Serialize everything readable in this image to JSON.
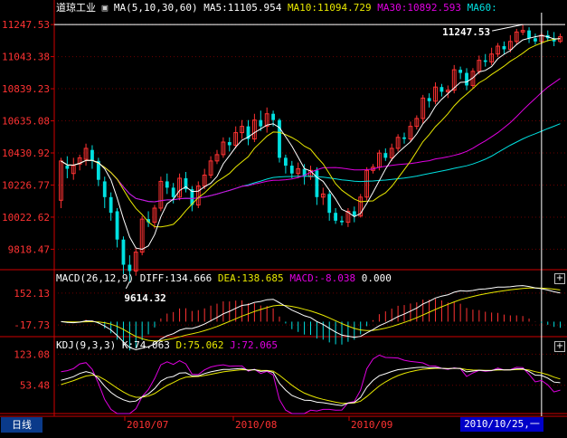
{
  "title": "道琼工业",
  "period_tab": "日线",
  "cursor_date": "2010/10/25,一",
  "colors": {
    "up": "#ff3232",
    "down": "#00e0e0",
    "ma5": "#ffffff",
    "ma10": "#e8e800",
    "ma30": "#e000e0",
    "ma60": "#00e0e0",
    "axis": "#d00000",
    "label": "#ff3232"
  },
  "legend_price": {
    "ma_label": "MA(5,10,30,60)",
    "ma5": "MA5:11105.954",
    "ma10": "MA10:11094.729",
    "ma30": "MA30:10892.593",
    "ma60": "MA60:"
  },
  "legend_macd": {
    "title": "MACD(26,12,9)",
    "diff": "DIFF:134.666",
    "dea": "DEA:138.685",
    "macd": "MACD:-8.038",
    "zero": "0.000"
  },
  "legend_kdj": {
    "title": "KDJ(9,3,3)",
    "k": "K:74.063",
    "d": "D:75.062",
    "j": "J:72.065"
  },
  "price_ticks": [
    "11247.53",
    "11043.38",
    "10839.23",
    "10635.08",
    "10430.92",
    "10226.77",
    "10022.62",
    "9818.47"
  ],
  "macd_ticks": [
    "152.13",
    "-17.73"
  ],
  "kdj_ticks": [
    "123.08",
    "53.48"
  ],
  "x_labels": [
    "2010/07",
    "2010/08",
    "2010/09"
  ],
  "chart_data": {
    "type": "candlestick",
    "title": "道琼工业",
    "period": "日线",
    "high_label": "11247.53",
    "low_label": "9614.32",
    "ylim": [
      9700,
      11300
    ],
    "candles": [
      [
        10130,
        10380,
        10080,
        10400
      ],
      [
        10350,
        10330,
        10270,
        10410
      ],
      [
        10300,
        10350,
        10260,
        10400
      ],
      [
        10360,
        10400,
        10320,
        10420
      ],
      [
        10390,
        10460,
        10350,
        10490
      ],
      [
        10450,
        10380,
        10330,
        10480
      ],
      [
        10380,
        10260,
        10220,
        10400
      ],
      [
        10250,
        10150,
        10080,
        10280
      ],
      [
        10150,
        10050,
        10000,
        10180
      ],
      [
        10060,
        9880,
        9830,
        10080
      ],
      [
        9880,
        9720,
        9660,
        9900
      ],
      [
        9720,
        9680,
        9614,
        9780
      ],
      [
        9680,
        9800,
        9650,
        9830
      ],
      [
        9800,
        10010,
        9780,
        10030
      ],
      [
        10010,
        9990,
        9960,
        10060
      ],
      [
        9990,
        10080,
        9950,
        10100
      ],
      [
        10080,
        10250,
        10060,
        10280
      ],
      [
        10250,
        10210,
        10170,
        10300
      ],
      [
        10210,
        10150,
        10110,
        10240
      ],
      [
        10150,
        10270,
        10130,
        10300
      ],
      [
        10270,
        10200,
        10180,
        10310
      ],
      [
        10200,
        10100,
        10060,
        10220
      ],
      [
        10100,
        10220,
        10080,
        10250
      ],
      [
        10220,
        10290,
        10200,
        10330
      ],
      [
        10290,
        10380,
        10270,
        10410
      ],
      [
        10380,
        10420,
        10360,
        10450
      ],
      [
        10420,
        10500,
        10400,
        10530
      ],
      [
        10500,
        10480,
        10440,
        10530
      ],
      [
        10480,
        10560,
        10460,
        10600
      ],
      [
        10560,
        10600,
        10520,
        10640
      ],
      [
        10600,
        10520,
        10480,
        10640
      ],
      [
        10520,
        10640,
        10500,
        10680
      ],
      [
        10640,
        10600,
        10570,
        10700
      ],
      [
        10600,
        10680,
        10560,
        10720
      ],
      [
        10680,
        10640,
        10600,
        10700
      ],
      [
        10640,
        10400,
        10370,
        10650
      ],
      [
        10400,
        10350,
        10300,
        10420
      ],
      [
        10350,
        10300,
        10270,
        10380
      ],
      [
        10300,
        10330,
        10270,
        10370
      ],
      [
        10330,
        10280,
        10230,
        10360
      ],
      [
        10280,
        10320,
        10260,
        10350
      ],
      [
        10320,
        10150,
        10100,
        10340
      ],
      [
        10150,
        10170,
        10100,
        10210
      ],
      [
        10170,
        10050,
        10000,
        10190
      ],
      [
        10050,
        10000,
        9980,
        10080
      ],
      [
        10000,
        9990,
        9970,
        10030
      ],
      [
        9990,
        10060,
        9960,
        10080
      ],
      [
        10060,
        10030,
        9990,
        10090
      ],
      [
        10030,
        10150,
        10020,
        10170
      ],
      [
        10150,
        10320,
        10130,
        10340
      ],
      [
        10320,
        10340,
        10300,
        10360
      ],
      [
        10340,
        10430,
        10320,
        10450
      ],
      [
        10430,
        10400,
        10380,
        10460
      ],
      [
        10400,
        10460,
        10380,
        10490
      ],
      [
        10460,
        10530,
        10440,
        10550
      ],
      [
        10530,
        10520,
        10490,
        10560
      ],
      [
        10520,
        10600,
        10500,
        10630
      ],
      [
        10600,
        10650,
        10580,
        10670
      ],
      [
        10650,
        10780,
        10620,
        10800
      ],
      [
        10780,
        10760,
        10720,
        10810
      ],
      [
        10760,
        10850,
        10740,
        10880
      ],
      [
        10850,
        10820,
        10790,
        10870
      ],
      [
        10820,
        10830,
        10780,
        10860
      ],
      [
        10830,
        10960,
        10810,
        10990
      ],
      [
        10960,
        10940,
        10900,
        10980
      ],
      [
        10940,
        10860,
        10830,
        10970
      ],
      [
        10860,
        10950,
        10840,
        10970
      ],
      [
        10950,
        11020,
        10930,
        11050
      ],
      [
        11020,
        11010,
        10980,
        11060
      ],
      [
        11010,
        11060,
        10990,
        11100
      ],
      [
        11060,
        11110,
        11040,
        11130
      ],
      [
        11110,
        11090,
        11060,
        11140
      ],
      [
        11090,
        11140,
        11070,
        11180
      ],
      [
        11140,
        11200,
        11120,
        11220
      ],
      [
        11200,
        11210,
        11180,
        11247.53
      ],
      [
        11210,
        11160,
        11130,
        11230
      ],
      [
        11160,
        11140,
        11120,
        11190
      ],
      [
        11140,
        11180,
        11120,
        11200
      ],
      [
        11180,
        11160,
        11140,
        11210
      ],
      [
        11160,
        11140,
        11110,
        11200
      ],
      [
        11140,
        11170,
        11130,
        11190
      ]
    ]
  }
}
